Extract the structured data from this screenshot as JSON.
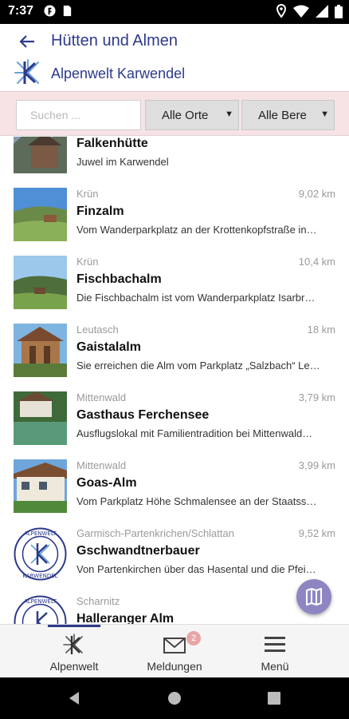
{
  "status_bar": {
    "time": "7:37"
  },
  "header": {
    "title": "Hütten und Almen",
    "brand_name": "Alpenwelt Karwendel"
  },
  "filters": {
    "search_placeholder": "Suchen ...",
    "location_select": "Alle Orte",
    "region_select": "Alle Bere"
  },
  "items": [
    {
      "location": "",
      "distance": "",
      "name": "Falkenhütte",
      "description": "Juwel im Karwendel"
    },
    {
      "location": "Krün",
      "distance": "9,02 km",
      "name": "Finzalm",
      "description": "Vom Wanderparkplatz an der Krottenkopfstraße in…"
    },
    {
      "location": "Krün",
      "distance": "10,4 km",
      "name": "Fischbachalm",
      "description": "Die Fischbachalm ist vom Wanderparkplatz Isarbr…"
    },
    {
      "location": "Leutasch",
      "distance": "18 km",
      "name": "Gaistalalm",
      "description": "Sie erreichen die Alm vom Parkplatz „Salzbach“ Le…"
    },
    {
      "location": "Mittenwald",
      "distance": "3,79 km",
      "name": "Gasthaus Ferchensee",
      "description": "Ausflugslokal mit Familientradition bei Mittenwald…"
    },
    {
      "location": "Mittenwald",
      "distance": "3,99 km",
      "name": "Goas-Alm",
      "description": "Vom Parkplatz Höhe Schmalensee an der Staatss…"
    },
    {
      "location": "Garmisch-Partenkrichen/Schlattan",
      "distance": "9,52 km",
      "name": "Gschwandtnerbauer",
      "description": "Von Partenkirchen über das Hasental und die Pfei…"
    },
    {
      "location": "Scharnitz",
      "distance": "",
      "name": "Halleranger Alm",
      "description": ""
    }
  ],
  "seal_text": {
    "top": "ALPENWELT",
    "bottom": "KARWENDEL"
  },
  "bottom_nav": {
    "home_label": "Alpenwelt",
    "messages_label": "Meldungen",
    "messages_badge": "2",
    "menu_label": "Menü"
  },
  "colors": {
    "brand": "#2d3a8c",
    "filter_bg": "#f7e3e6",
    "fab": "#8e86c2"
  }
}
